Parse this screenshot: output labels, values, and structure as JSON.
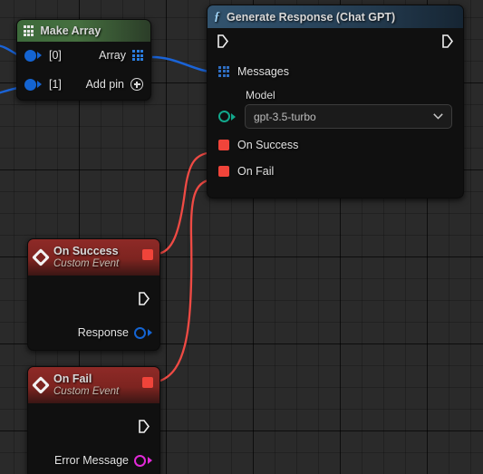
{
  "app": {
    "name": "Unreal Engine Blueprint Graph",
    "background_color": "#2a2a2a",
    "grid_color": "#000000"
  },
  "nodes": [
    {
      "id": "make-array",
      "title": "Make Array",
      "icon": "array-grid-icon",
      "header_color": "#3d6b3b",
      "inputs": [
        {
          "label": "[0]",
          "pin": "wildcard-pin",
          "color": "#1464d2",
          "connected": true
        },
        {
          "label": "[1]",
          "pin": "wildcard-pin",
          "color": "#1464d2",
          "connected": true
        }
      ],
      "outputs": [
        {
          "label": "Array",
          "pin": "array-pin",
          "color": "#2a7ee0",
          "connected": true
        }
      ],
      "actions": [
        {
          "label": "Add pin",
          "icon": "add-pin-icon"
        }
      ]
    },
    {
      "id": "generate-response",
      "title": "Generate Response (Chat GPT)",
      "icon": "function-icon",
      "header_color": "#2c4a63",
      "exec_in": "exec-in-pin",
      "exec_out": "exec-out-pin",
      "inputs": [
        {
          "label": "Messages",
          "pin": "array-pin",
          "color": "#2a7ee0",
          "connected": true
        }
      ],
      "property": {
        "label": "Model",
        "pin": "string-pin",
        "pin_color": "#12a88c",
        "value": "gpt-3.5-turbo",
        "placeholder": "gpt-3.5-turbo",
        "options": [
          "gpt-3.5-turbo"
        ]
      },
      "delegates": [
        {
          "label": "On Success",
          "pin": "delegate-pin",
          "color": "#f0443a",
          "connected": true
        },
        {
          "label": "On Fail",
          "pin": "delegate-pin",
          "color": "#f0443a",
          "connected": true
        }
      ]
    },
    {
      "id": "on-success",
      "title": "On Success",
      "subtitle": "Custom Event",
      "icon": "event-diamond-icon",
      "header_color": "#8e2a27",
      "delegate_pin": {
        "pin": "delegate-pin",
        "color": "#f0443a",
        "connected": true
      },
      "exec_out": "exec-out-pin",
      "outputs": [
        {
          "label": "Response",
          "pin": "object-pin",
          "color": "#1464d2",
          "connected": false
        }
      ]
    },
    {
      "id": "on-fail",
      "title": "On Fail",
      "subtitle": "Custom Event",
      "icon": "event-diamond-icon",
      "header_color": "#8e2a27",
      "delegate_pin": {
        "pin": "delegate-pin",
        "color": "#f0443a",
        "connected": true
      },
      "exec_out": "exec-out-pin",
      "outputs": [
        {
          "label": "Error Message",
          "pin": "text-pin",
          "color": "#e22ad8",
          "connected": false
        }
      ]
    }
  ],
  "wires": [
    {
      "from": "offscreen-left",
      "to": "make-array.[0]",
      "color": "#1464d2",
      "type": "data"
    },
    {
      "from": "offscreen-left",
      "to": "make-array.[1]",
      "color": "#1464d2",
      "type": "data"
    },
    {
      "from": "make-array.Array",
      "to": "generate-response.Messages",
      "color": "#1a63d6",
      "type": "data"
    },
    {
      "from": "generate-response.On Success",
      "to": "on-success.delegate",
      "color": "#ef4a44",
      "type": "delegate"
    },
    {
      "from": "generate-response.On Fail",
      "to": "on-fail.delegate",
      "color": "#ef4a44",
      "type": "delegate"
    }
  ]
}
